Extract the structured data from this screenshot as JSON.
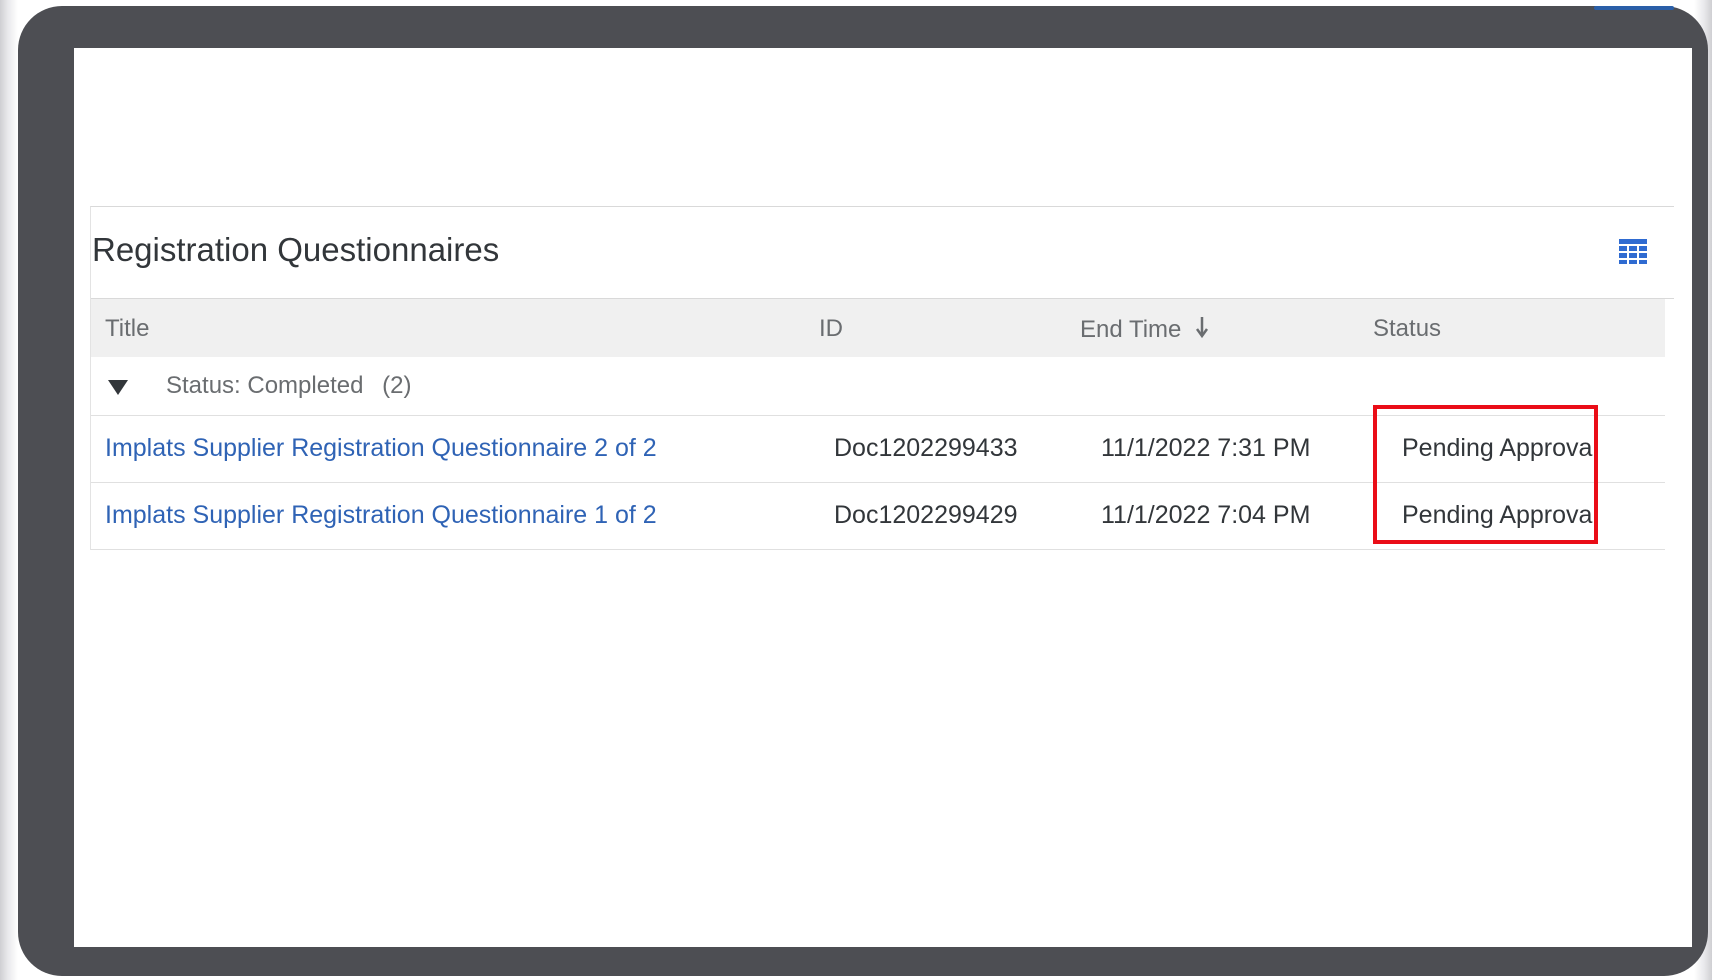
{
  "panel": {
    "title": "Registration Questionnaires",
    "settings_icon": "table-settings-icon"
  },
  "table": {
    "columns": {
      "title": "Title",
      "id": "ID",
      "end_time": "End Time",
      "status": "Status"
    },
    "sort_icon": "sort-descending-icon",
    "group": {
      "label": "Status: Completed",
      "count": "(2)",
      "expanded": true
    },
    "rows": [
      {
        "title": "Implats Supplier Registration Questionnaire 2 of 2",
        "id": "Doc1202299433",
        "end_time": "11/1/2022 7:31 PM",
        "status": "Pending Approval"
      },
      {
        "title": "Implats Supplier Registration Questionnaire 1 of 2",
        "id": "Doc1202299429",
        "end_time": "11/1/2022 7:04 PM",
        "status": "Pending Approval"
      }
    ]
  },
  "colors": {
    "link": "#2f63b5",
    "highlight": "#ea0d17",
    "icon": "#2f6bd1",
    "bezel": "#4d4e53"
  }
}
